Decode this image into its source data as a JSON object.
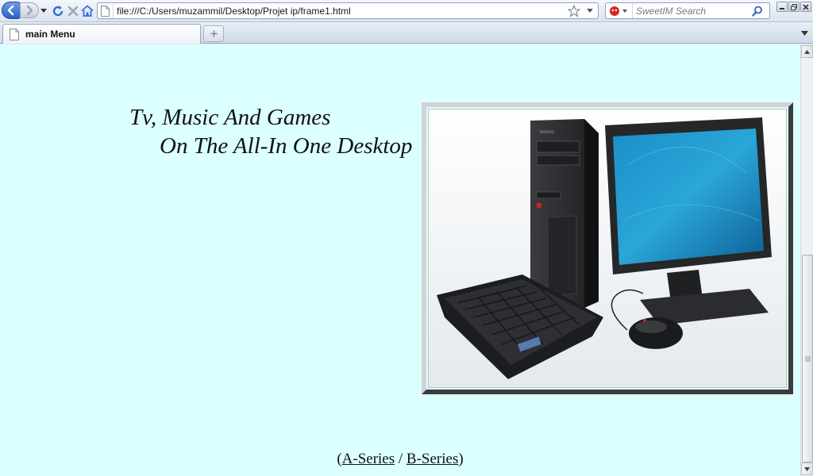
{
  "browser": {
    "address": "file:///C:/Users/muzammil/Desktop/Projet ip/frame1.html",
    "search_placeholder": "SweetIM Search",
    "icons": {
      "back": "back-arrow-icon",
      "forward": "forward-arrow-icon",
      "history": "dropdown-arrow-icon",
      "reload": "reload-icon",
      "stop": "stop-icon",
      "home": "home-icon",
      "page": "page-icon",
      "bookmark": "star-icon",
      "search_engine": "sweetim-logo-icon",
      "search": "magnifier-icon"
    },
    "colors": {
      "accent": "#2c5fc7",
      "chrome": "#dbe4f0"
    }
  },
  "tabs": [
    {
      "label": "main Menu",
      "active": true
    }
  ],
  "page": {
    "headline_line1": "Tv, Music And Games",
    "headline_line2": "On The All-In One Desktop",
    "image_subject": "desktop computer with monitor, tower, keyboard and mouse",
    "links_open": "(",
    "link_a": "A-Series",
    "links_separator": " / ",
    "link_b": "B-Series",
    "links_close": ")",
    "background_color": "#dcffff"
  }
}
